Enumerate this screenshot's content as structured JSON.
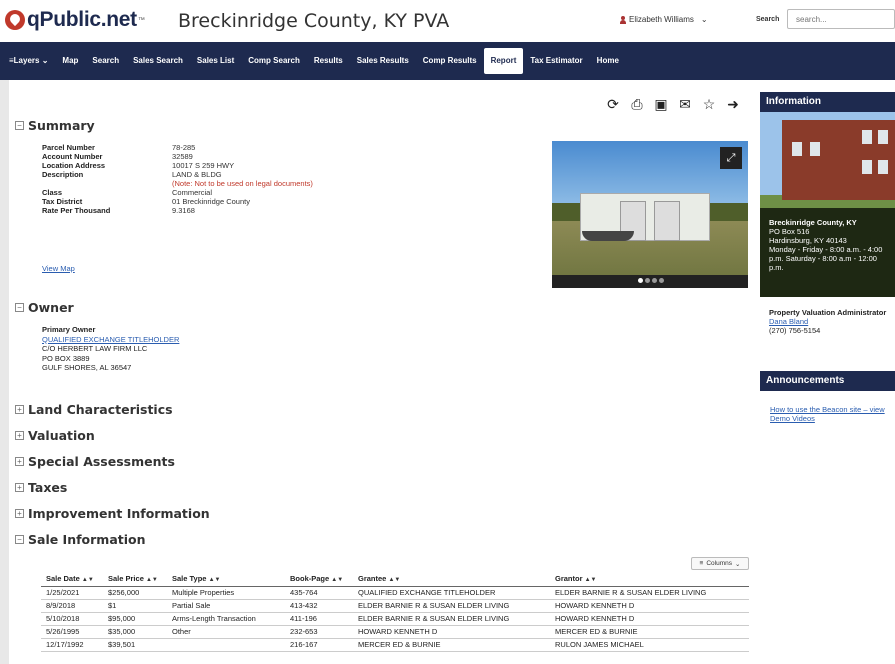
{
  "header": {
    "logo_text": "qPublic.net",
    "logo_tm": "™",
    "county_title": "Breckinridge County, KY PVA",
    "user_name": "Elizabeth Williams",
    "search_label": "Search",
    "search_placeholder": "search..."
  },
  "nav": {
    "items": [
      {
        "label": "Layers"
      },
      {
        "label": "Map"
      },
      {
        "label": "Search"
      },
      {
        "label": "Sales Search"
      },
      {
        "label": "Sales List"
      },
      {
        "label": "Comp Search"
      },
      {
        "label": "Results"
      },
      {
        "label": "Sales Results"
      },
      {
        "label": "Comp Results"
      },
      {
        "label": "Report"
      },
      {
        "label": "Tax Estimator"
      },
      {
        "label": "Home"
      }
    ],
    "active": "Report"
  },
  "toolbar": {
    "icons": [
      "share-icon",
      "print-icon",
      "image-icon",
      "email-icon",
      "star-icon",
      "arrow-right-icon"
    ]
  },
  "summary": {
    "title": "Summary",
    "rows": [
      {
        "label": "Parcel Number",
        "value": "78-285"
      },
      {
        "label": "Account Number",
        "value": "32589"
      },
      {
        "label": "Location Address",
        "value": "10017 S 259 HWY"
      },
      {
        "label": "Description",
        "value": "LAND & BLDG"
      },
      {
        "label": "",
        "value": "(Note: Not to be used on legal documents)",
        "note": true
      },
      {
        "label": "Class",
        "value": "Commercial"
      },
      {
        "label": "Tax District",
        "value": "01 Breckinridge County"
      },
      {
        "label": "Rate Per Thousand",
        "value": "9.3168"
      }
    ],
    "view_map": "View Map"
  },
  "owner": {
    "title": "Owner",
    "label": "Primary Owner",
    "name": "QUALIFIED EXCHANGE TITLEHOLDER",
    "lines": [
      "C/O HERBERT LAW FIRM LLC",
      "PO BOX 3889",
      "GULF SHORES, AL 36547"
    ]
  },
  "collapsed_sections": [
    "Land Characteristics",
    "Valuation",
    "Special Assessments",
    "Taxes",
    "Improvement Information"
  ],
  "sale_info": {
    "title": "Sale Information",
    "columns_button": "Columns",
    "headers": [
      "Sale Date",
      "Sale Price",
      "Sale Type",
      "Book-Page",
      "Grantee",
      "Grantor"
    ],
    "rows": [
      [
        "1/25/2021",
        "$256,000",
        "Multiple Properties",
        "435-764",
        "QUALIFIED EXCHANGE TITLEHOLDER",
        "ELDER BARNIE R & SUSAN ELDER LIVING"
      ],
      [
        "8/9/2018",
        "$1",
        "Partial Sale",
        "413-432",
        "ELDER BARNIE R & SUSAN ELDER LIVING",
        "HOWARD KENNETH D"
      ],
      [
        "5/10/2018",
        "$95,000",
        "Arms-Length Transaction",
        "411-196",
        "ELDER BARNIE R & SUSAN ELDER LIVING",
        "HOWARD KENNETH D"
      ],
      [
        "5/26/1995",
        "$35,000",
        "Other",
        "232-653",
        "HOWARD KENNETH D",
        "MERCER ED & BURNIE"
      ],
      [
        "12/17/1992",
        "$39,501",
        "",
        "216-167",
        "MERCER ED & BURNIE",
        "RULON JAMES MICHAEL"
      ]
    ]
  },
  "sidebar": {
    "info_title": "Information",
    "office_name": "Breckinridge County, KY",
    "office_lines": [
      "PO Box 516",
      "Hardinsburg, KY 40143",
      "Monday - Friday - 8:00 a.m. - 4:00 p.m. Saturday - 8:00 a.m - 12:00 p.m."
    ],
    "pva_title": "Property Valuation Administrator",
    "pva_name": "Dana Bland",
    "pva_phone": "(270) 756-5154",
    "ann_title": "Announcements",
    "ann_link": "How to use the Beacon site – view Demo Videos"
  },
  "colors": {
    "navy": "#1e2a4f",
    "logo_red": "#c0392b",
    "link": "#2a5db0",
    "note_red": "#c0392b"
  }
}
